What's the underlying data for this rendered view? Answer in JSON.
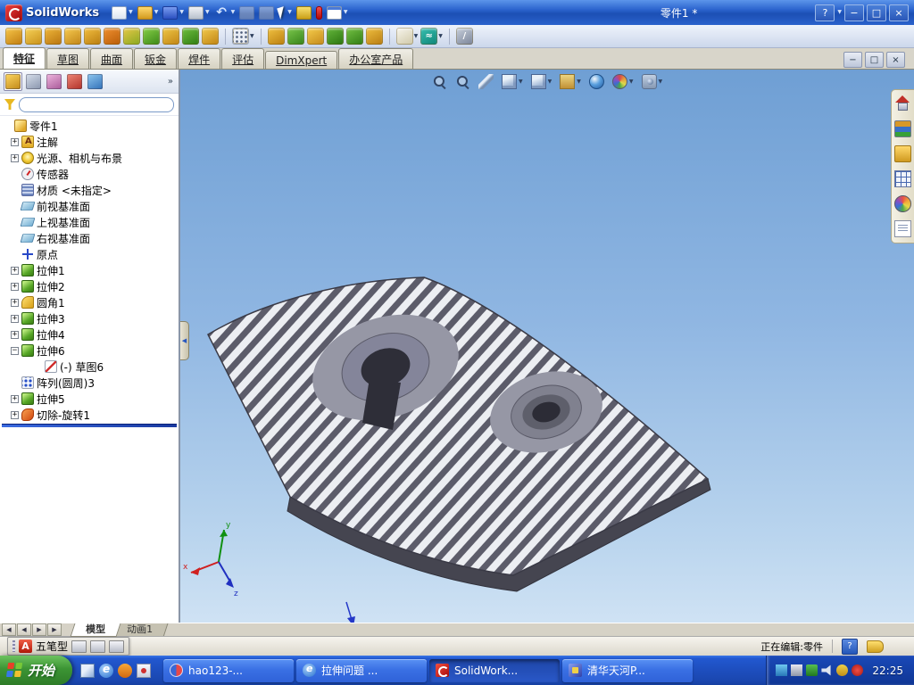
{
  "app": {
    "name": "SolidWorks",
    "doc_title": "零件1 *"
  },
  "glyphs": {
    "caret": "▼",
    "overflow": "»",
    "collapse_arrow": "◀"
  },
  "titlebar": {
    "tools": [
      {
        "name": "new-document-button",
        "icon": "new-document-icon",
        "kind": "tt-new",
        "caret": true
      },
      {
        "name": "open-document-button",
        "icon": "open-folder-icon",
        "kind": "tt-open",
        "caret": true
      },
      {
        "name": "save-button",
        "icon": "save-disk-icon",
        "kind": "tt-save",
        "caret": true
      },
      {
        "name": "print-button",
        "icon": "printer-icon",
        "kind": "tt-print",
        "caret": true
      },
      {
        "name": "undo-button",
        "icon": "undo-arrow-icon",
        "kind": "tt-undo",
        "glyph": "↶",
        "caret": true
      },
      {
        "name": "copy-button",
        "icon": "copy-icon",
        "kind": "tt-copy"
      },
      {
        "name": "paste-button",
        "icon": "paste-icon",
        "kind": "tt-paste"
      },
      {
        "name": "select-button",
        "icon": "select-cursor-icon",
        "kind": "tt-select",
        "caret": true
      },
      {
        "name": "measure-button",
        "icon": "meas​ure-pen-icon",
        "kind": "tt-measure"
      },
      {
        "name": "color-swatch-button",
        "icon": "red-swatch-icon",
        "kind": "tt-red"
      },
      {
        "name": "options-button",
        "icon": "options-form-icon",
        "kind": "tt-form",
        "caret": true
      }
    ],
    "help": "?",
    "min": "−",
    "max": "□",
    "close": "×"
  },
  "feature_toolbar": {
    "items": [
      {
        "name": "feature-tool-1",
        "c1": "#f8c84a",
        "c2": "#c07c10"
      },
      {
        "name": "feature-tool-2",
        "c1": "#f8d45a",
        "c2": "#c8901a"
      },
      {
        "name": "feature-tool-3",
        "c1": "#f0b83a",
        "c2": "#b87410"
      },
      {
        "name": "feature-tool-4",
        "c1": "#f8cc50",
        "c2": "#c08418"
      },
      {
        "name": "feature-tool-5",
        "c1": "#f4c040",
        "c2": "#b87c10"
      },
      {
        "name": "feature-tool-6",
        "c1": "#f09030",
        "c2": "#b85c08"
      },
      {
        "name": "feature-tool-7",
        "c1": "#e8c848",
        "c2": "#88a820"
      },
      {
        "name": "feature-tool-8",
        "c1": "#88d048",
        "c2": "#3a8818"
      },
      {
        "name": "feature-tool-9",
        "c1": "#f0c846",
        "c2": "#c08414"
      },
      {
        "name": "feature-tool-10",
        "c1": "#70c040",
        "c2": "#2f7c12"
      },
      {
        "name": "feature-tool-11",
        "c1": "#f4cc4e",
        "c2": "#bf8312"
      },
      {
        "sep": true
      },
      {
        "name": "feature-tool-grid",
        "kind": "ft-dots",
        "caret": true
      },
      {
        "sep": true
      },
      {
        "name": "feature-tool-12",
        "c1": "#f2c342",
        "c2": "#ba7e10"
      },
      {
        "name": "feature-tool-13",
        "c1": "#7cc84c",
        "c2": "#35821a"
      },
      {
        "name": "feature-tool-14",
        "c1": "#f6ce4c",
        "c2": "#c4891b"
      },
      {
        "name": "feature-tool-15",
        "c1": "#66b83c",
        "c2": "#2a7410"
      },
      {
        "name": "feature-tool-16",
        "c1": "#74c244",
        "c2": "#317c14"
      },
      {
        "name": "feature-tool-17",
        "c1": "#f0c040",
        "c2": "#b87c12"
      },
      {
        "sep": true
      },
      {
        "name": "feature-tool-18",
        "c1": "#f8f6ee",
        "c2": "#cfc8a8",
        "caret": true
      },
      {
        "name": "feature-tool-spline",
        "c1": "#38c0b0",
        "c2": "#0e8478",
        "caret": true,
        "glyph": "≈"
      },
      {
        "sep": true
      },
      {
        "name": "feature-tool-pencil",
        "c1": "#c8d0dc",
        "c2": "#7a8498",
        "glyph": "/"
      }
    ]
  },
  "command_manager": {
    "tabs": [
      {
        "id": "features",
        "label": "特征",
        "active": true
      },
      {
        "id": "sketch",
        "label": "草图"
      },
      {
        "id": "surfaces",
        "label": "曲面"
      },
      {
        "id": "sheet-metal",
        "label": "钣金"
      },
      {
        "id": "weldments",
        "label": "焊件"
      },
      {
        "id": "evaluate",
        "label": "评估"
      },
      {
        "id": "dimxpert",
        "label": "DimXpert"
      },
      {
        "id": "office-products",
        "label": "办公室产品"
      }
    ]
  },
  "doc_controls": {
    "min": "−",
    "restore": "□",
    "close": "×"
  },
  "feature_manager": {
    "header_tabs": [
      {
        "name": "featuremanager-tab",
        "icon": "featuremanager-icon",
        "c1": "#ffd862",
        "c2": "#c08818"
      },
      {
        "name": "propertymanager-tab",
        "icon": "propertymanager-icon",
        "c1": "#d8e0ec",
        "c2": "#8894ac"
      },
      {
        "name": "configurationmanager-tab",
        "icon": "configurationmanager-icon",
        "c1": "#f0b8e0",
        "c2": "#a85898"
      },
      {
        "name": "dimxpertmanager-tab",
        "icon": "dimxpertmanager-icon",
        "c1": "#f08878",
        "c2": "#b03028"
      },
      {
        "name": "displaymanager-tab",
        "icon": "displaymanager-icon",
        "c1": "#90c8f0",
        "c2": "#3070b8"
      }
    ],
    "items": [
      {
        "id": "part-root",
        "level": 0,
        "expand": "",
        "icon": "part",
        "label": "零件1"
      },
      {
        "id": "annotations",
        "level": 1,
        "expand": "+",
        "icon": "annotations",
        "label": "注解"
      },
      {
        "id": "lights-cameras-scene",
        "level": 1,
        "expand": "+",
        "icon": "lights",
        "label": "光源、相机与布景"
      },
      {
        "id": "sensors",
        "level": 1,
        "expand": "",
        "icon": "sensors",
        "label": "传感器"
      },
      {
        "id": "material",
        "level": 1,
        "expand": "",
        "icon": "material",
        "label": "材质 <未指定>"
      },
      {
        "id": "front-plane",
        "level": 1,
        "expand": "",
        "icon": "plane",
        "label": "前视基准面"
      },
      {
        "id": "top-plane",
        "level": 1,
        "expand": "",
        "icon": "plane",
        "label": "上视基准面"
      },
      {
        "id": "right-plane",
        "level": 1,
        "expand": "",
        "icon": "plane",
        "label": "右视基准面"
      },
      {
        "id": "origin",
        "level": 1,
        "expand": "",
        "icon": "origin",
        "label": "原点"
      },
      {
        "id": "extrude1",
        "level": 1,
        "expand": "+",
        "icon": "extrude",
        "label": "拉伸1"
      },
      {
        "id": "extrude2",
        "level": 1,
        "expand": "+",
        "icon": "extrude",
        "label": "拉伸2"
      },
      {
        "id": "fillet1",
        "level": 1,
        "expand": "+",
        "icon": "fillet",
        "label": "圆角1"
      },
      {
        "id": "extrude3",
        "level": 1,
        "expand": "+",
        "icon": "extrude",
        "label": "拉伸3"
      },
      {
        "id": "extrude4",
        "level": 1,
        "expand": "+",
        "icon": "extrude",
        "label": "拉伸4"
      },
      {
        "id": "extrude6",
        "level": 1,
        "expand": "−",
        "icon": "extrude",
        "label": "拉伸6"
      },
      {
        "id": "sketch6",
        "level": 2,
        "expand": "",
        "icon": "sketch",
        "label": "(-) 草图6"
      },
      {
        "id": "circular-pattern3",
        "level": 1,
        "expand": "",
        "icon": "pattern",
        "label": "阵列(圆周)3"
      },
      {
        "id": "extrude5",
        "level": 1,
        "expand": "+",
        "icon": "extrude",
        "label": "拉伸5"
      },
      {
        "id": "cut-revolve1",
        "level": 1,
        "expand": "+",
        "icon": "cutrevolve",
        "label": "切除-旋转1"
      }
    ]
  },
  "viewport": {
    "hud": [
      {
        "name": "zoom-to-fit",
        "icon": "magnifier-icon",
        "kind": "h-mag"
      },
      {
        "name": "zoom-to-area",
        "icon": "magnifier-icon",
        "kind": "h-mag"
      },
      {
        "name": "section-view",
        "icon": "section-blade-icon",
        "kind": "h-blade"
      },
      {
        "name": "view-orientation",
        "icon": "view-cube-icon",
        "kind": "h-cube",
        "caret": true
      },
      {
        "name": "display-style",
        "icon": "display-cube-icon",
        "kind": "h-cube",
        "caret": true
      },
      {
        "name": "hide-show-items",
        "icon": "hide-show-icon",
        "kind": "h-book",
        "caret": true
      },
      {
        "name": "edit-appearance",
        "icon": "appearance-sphere-icon",
        "kind": "h-ball"
      },
      {
        "name": "apply-scene",
        "icon": "scene-sphere-icon",
        "kind": "h-ball2",
        "caret": true
      },
      {
        "name": "view-settings",
        "icon": "camera-icon",
        "kind": "h-cam",
        "caret": true
      }
    ]
  },
  "task_pane": {
    "items": [
      {
        "name": "solidworks-resources",
        "icon": "home-icon",
        "kind": "tp-home"
      },
      {
        "name": "design-library",
        "icon": "library-icon",
        "kind": "tp-lib"
      },
      {
        "name": "file-explorer",
        "icon": "folder-icon",
        "kind": "tp-folder"
      },
      {
        "name": "view-palette",
        "icon": "palette-grid-icon",
        "kind": "tp-grid"
      },
      {
        "name": "appearances-scenes",
        "icon": "globe-icon",
        "kind": "tp-globe"
      },
      {
        "name": "custom-properties",
        "icon": "document-icon",
        "kind": "tp-doc"
      }
    ]
  },
  "model_tabs": {
    "nav": [
      "◀",
      "◀",
      "▶",
      "▶"
    ],
    "tabs": [
      {
        "id": "model",
        "label": "模型",
        "active": true
      },
      {
        "id": "motion-study-1",
        "label": "动画1"
      }
    ]
  },
  "status": {
    "editing": "正在编辑:零件",
    "help": "?"
  },
  "ime": {
    "indicator": "A",
    "label": "五笔型"
  },
  "taskbar": {
    "start_label": "开始",
    "quick_launch": [
      {
        "name": "show-desktop",
        "icon": "desktop-icon",
        "kind": "q1"
      },
      {
        "name": "internet-explorer",
        "icon": "ie-icon",
        "kind": "q2"
      },
      {
        "name": "media-player",
        "icon": "media-icon",
        "kind": "q3"
      },
      {
        "name": "mail",
        "icon": "mail-icon",
        "kind": "q4"
      }
    ],
    "tasks": [
      {
        "id": "hao123",
        "label": "hao123-...",
        "icon": "hao123-icon",
        "kind": "tk-hao"
      },
      {
        "id": "lashen-wenti",
        "label": "拉伸问题 ...",
        "icon": "browser-icon",
        "kind": "tk-ie"
      },
      {
        "id": "solidworks",
        "label": "SolidWork...",
        "icon": "solidworks-icon",
        "kind": "tk-sw",
        "active": true
      },
      {
        "id": "qinghua-tianhe",
        "label": "清华天河P...",
        "icon": "tianhe-icon",
        "kind": "tk-th"
      }
    ],
    "tray": [
      {
        "name": "display-settings",
        "icon": "monitor-icon",
        "kind": "t1"
      },
      {
        "name": "ime-indicator",
        "icon": "ime-icon",
        "kind": "t2"
      },
      {
        "name": "security-shield",
        "icon": "shield-icon",
        "kind": "t3"
      },
      {
        "name": "volume",
        "icon": "speaker-icon",
        "kind": "t4"
      },
      {
        "name": "network",
        "icon": "network-icon",
        "kind": "t5"
      },
      {
        "name": "antivirus",
        "icon": "antivirus-icon",
        "kind": "t6"
      }
    ],
    "clock": "22:25"
  }
}
